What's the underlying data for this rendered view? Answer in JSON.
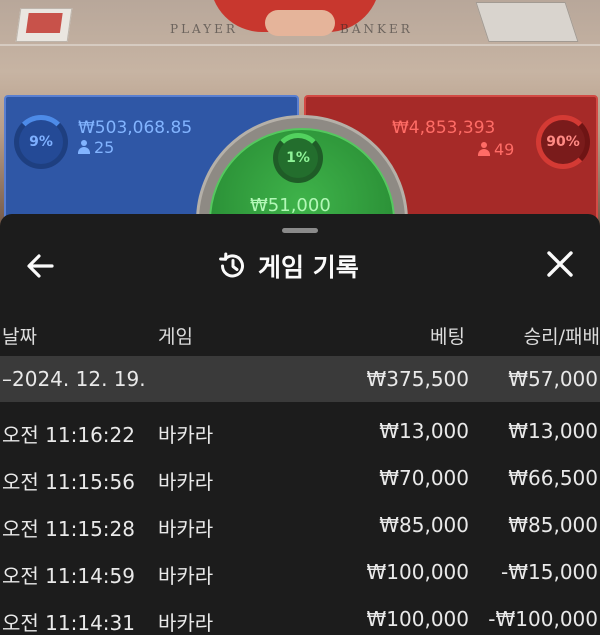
{
  "table": {
    "player_label": "PLAYER",
    "banker_label": "BANKER",
    "player": {
      "percent": "9%",
      "amount": "₩503,068.85",
      "count": "25"
    },
    "tie": {
      "percent": "1%",
      "amount": "₩51,000"
    },
    "banker": {
      "percent": "90%",
      "amount": "₩4,853,393",
      "count": "49"
    }
  },
  "history": {
    "title": "게임 기록",
    "back_icon": "arrow-left-icon",
    "history_icon": "history-clock-icon",
    "close_icon": "close-icon",
    "columns": {
      "date": "날짜",
      "game": "게임",
      "bet": "베팅",
      "win": "승리/패배"
    },
    "summary": {
      "date": "–2024. 12. 19.",
      "bet": "₩375,500",
      "win": "₩57,000"
    },
    "rows": [
      {
        "time": "오전 11:16:22",
        "game": "바카라",
        "bet": "₩13,000",
        "win": "₩13,000"
      },
      {
        "time": "오전 11:15:56",
        "game": "바카라",
        "bet": "₩70,000",
        "win": "₩66,500"
      },
      {
        "time": "오전 11:15:28",
        "game": "바카라",
        "bet": "₩85,000",
        "win": "₩85,000"
      },
      {
        "time": "오전 11:14:59",
        "game": "바카라",
        "bet": "₩100,000",
        "win": "-₩15,000"
      },
      {
        "time": "오전 11:14:31",
        "game": "바카라",
        "bet": "₩100,000",
        "win": "-₩100,000"
      }
    ]
  },
  "colors": {
    "sheet_bg": "#1c1c1c",
    "summary_row_bg": "#3a3a3a",
    "player_blue": "#2f57a6",
    "banker_red": "#a62a28",
    "tie_green": "#2a8f36"
  }
}
